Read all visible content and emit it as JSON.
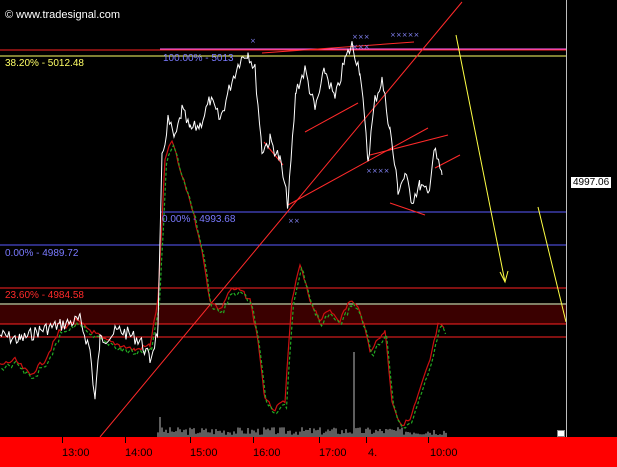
{
  "watermark": {
    "text": "© www.tradesignal.com"
  },
  "levels": {
    "fib_382": {
      "text": "38.20% - 5012.48",
      "color": "#ffff66"
    },
    "fib_100": {
      "text": "100.00% - 5013",
      "color": "#6a6aff"
    },
    "fib_0_a": {
      "text": "0.00% - 4993.68",
      "color": "#6a6aff"
    },
    "fib_0_b": {
      "text": "0.00% - 4989.72",
      "color": "#6a6aff"
    },
    "fib_236": {
      "text": "23.60% - 4984.58",
      "color": "#ff2222"
    }
  },
  "price_scale": {
    "last_price": "4997.06"
  },
  "time_axis": {
    "labels": [
      "13:00",
      "14:00",
      "15:00",
      "16:00",
      "17:00",
      "4.",
      "10:00"
    ]
  },
  "colors": {
    "axis_bg": "#ff0000",
    "price": "#ffffff",
    "indicator_fast": "#22aa22",
    "indicator_slow": "#cc1111",
    "trendline": "#ff2a2a",
    "arrow": "#ffff44"
  }
}
